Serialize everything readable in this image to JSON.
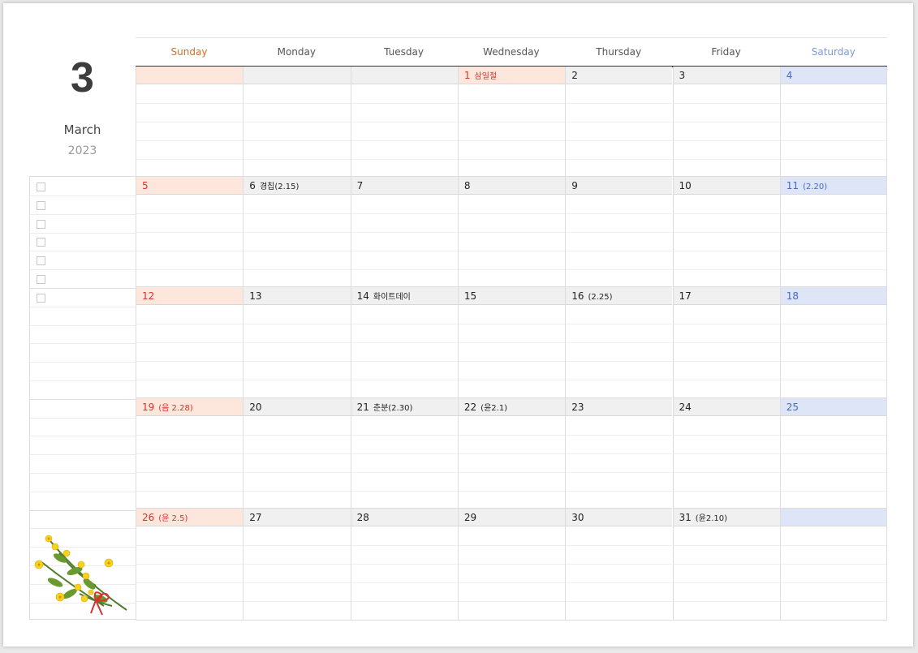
{
  "month_number": "3",
  "month_name": "March",
  "year": "2023",
  "weekdays": [
    "Sunday",
    "Monday",
    "Tuesday",
    "Wednesday",
    "Thursday",
    "Friday",
    "Saturday"
  ],
  "colors": {
    "sunday_text": "#e06a26",
    "saturday_text": "#7d9ad6",
    "sunday_bg": "#fde6dc",
    "saturday_bg": "#dde5f6",
    "weekday_bg": "#f0f0f0",
    "holiday_text": "#d8322c"
  },
  "weeks": [
    [
      {
        "day": "",
        "note": ""
      },
      {
        "day": "",
        "note": ""
      },
      {
        "day": "",
        "note": ""
      },
      {
        "day": "1",
        "note": "삼일절",
        "holiday": true
      },
      {
        "day": "2",
        "note": ""
      },
      {
        "day": "3",
        "note": ""
      },
      {
        "day": "4",
        "note": ""
      }
    ],
    [
      {
        "day": "5",
        "note": ""
      },
      {
        "day": "6",
        "note": "경칩(2.15)"
      },
      {
        "day": "7",
        "note": ""
      },
      {
        "day": "8",
        "note": ""
      },
      {
        "day": "9",
        "note": ""
      },
      {
        "day": "10",
        "note": ""
      },
      {
        "day": "11",
        "note": "(2.20)"
      }
    ],
    [
      {
        "day": "12",
        "note": ""
      },
      {
        "day": "13",
        "note": ""
      },
      {
        "day": "14",
        "note": "화이트데이"
      },
      {
        "day": "15",
        "note": ""
      },
      {
        "day": "16",
        "note": "(2.25)"
      },
      {
        "day": "17",
        "note": ""
      },
      {
        "day": "18",
        "note": ""
      }
    ],
    [
      {
        "day": "19",
        "note": "(음 2.28)"
      },
      {
        "day": "20",
        "note": ""
      },
      {
        "day": "21",
        "note": "춘분(2.30)"
      },
      {
        "day": "22",
        "note": "(윤2.1)"
      },
      {
        "day": "23",
        "note": ""
      },
      {
        "day": "24",
        "note": ""
      },
      {
        "day": "25",
        "note": ""
      }
    ],
    [
      {
        "day": "26",
        "note": "(윤 2.5)"
      },
      {
        "day": "27",
        "note": ""
      },
      {
        "day": "28",
        "note": ""
      },
      {
        "day": "29",
        "note": ""
      },
      {
        "day": "30",
        "note": ""
      },
      {
        "day": "31",
        "note": "(윤2.10)"
      },
      {
        "day": "",
        "note": ""
      }
    ]
  ],
  "notes_checkboxes": 7,
  "decoration_icon": "forsythia-flower-illustration"
}
